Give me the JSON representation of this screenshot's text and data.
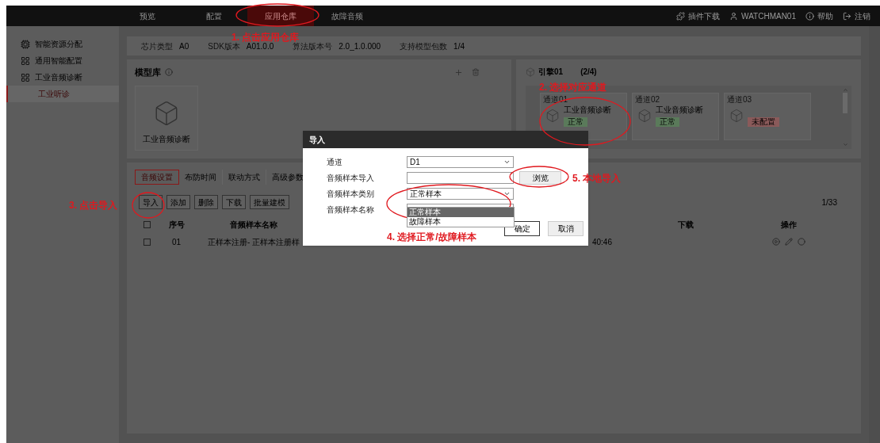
{
  "nav": {
    "items": [
      {
        "label": "预览",
        "selected": false
      },
      {
        "label": "配置",
        "selected": false
      },
      {
        "label": "应用仓库",
        "selected": true
      },
      {
        "label": "故障音频",
        "selected": false
      }
    ],
    "tools": [
      {
        "kind": "plugin",
        "label": "插件下载"
      },
      {
        "kind": "user",
        "label": "WATCHMAN01"
      },
      {
        "kind": "help",
        "label": "帮助"
      },
      {
        "kind": "logout",
        "label": "注销"
      }
    ]
  },
  "sidebar": {
    "items": [
      {
        "kind": "resource",
        "label": "智能资源分配",
        "selected": false
      },
      {
        "kind": "grid",
        "label": "通用智能配置",
        "selected": false
      },
      {
        "kind": "grid",
        "label": "工业音频诊断",
        "selected": false,
        "children": [
          {
            "label": "工业听诊",
            "selected": true
          }
        ]
      }
    ]
  },
  "info_bar": [
    {
      "label": "芯片类型",
      "value": "A0"
    },
    {
      "label": "SDK版本",
      "value": "A01.0.0"
    },
    {
      "label": "算法版本号",
      "value": "2.0_1.0.000"
    },
    {
      "label": "支持模型包数",
      "value": "1/4"
    }
  ],
  "model_library": {
    "title": "模型库",
    "models": [
      {
        "name": "工业音频诊断"
      }
    ]
  },
  "engine": {
    "title": "引擎01",
    "count": "(2/4)",
    "channels": [
      {
        "name": "通道01",
        "model": "工业音频诊断",
        "status": "正常",
        "color": "#5a7a5a"
      },
      {
        "name": "通道02",
        "model": "工业音频诊断",
        "status": "正常",
        "color": "#5a7a5a"
      },
      {
        "name": "通道03",
        "status": "未配置",
        "color": "#8a5a5a"
      }
    ]
  },
  "steps": [
    {
      "label": "音频设置",
      "selected": true
    },
    {
      "label": "布防时间",
      "selected": false
    },
    {
      "label": "联动方式",
      "selected": false
    },
    {
      "label": "高级参数",
      "selected": false
    }
  ],
  "toolbar": [
    "导入",
    "添加",
    "删除",
    "下载",
    "批量建模"
  ],
  "page_indicator": "1/33",
  "table": {
    "header_checked": false,
    "columns": [
      "序号",
      "音频样本名称",
      "下载",
      "操作"
    ],
    "rows": [
      {
        "checked": false,
        "index": "01",
        "name": "正样本注册- 正样本注册样",
        "column_3": "40:46"
      }
    ]
  },
  "dialog": {
    "title": "导入",
    "fields": [
      {
        "kind": "select",
        "label": "通道",
        "value": "D1"
      },
      {
        "kind": "file",
        "label": "音频样本导入",
        "button": "浏览"
      },
      {
        "kind": "select",
        "label": "音频样本类别",
        "value": "正常样本",
        "expanded": true,
        "options": [
          {
            "label": "正常样本",
            "selected": true
          },
          {
            "label": "故障样本",
            "selected": false
          }
        ]
      },
      {
        "kind": "text",
        "label": "音频样本名称"
      }
    ],
    "buttons": [
      "确定",
      "取消"
    ]
  },
  "annotations": [
    {
      "text": "1. 点击应用仓库"
    },
    {
      "text": "2. 选择对应通道"
    },
    {
      "text": "3. 点击导入"
    },
    {
      "text": "4. 选择正常/故障样本"
    },
    {
      "text": "5. 本地导入"
    }
  ]
}
